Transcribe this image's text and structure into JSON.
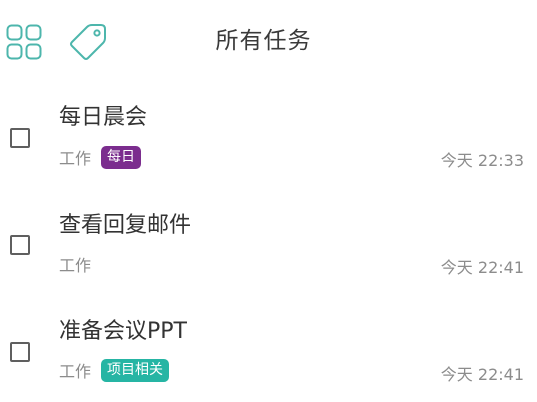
{
  "header": {
    "title": "所有任务",
    "menu_icon": "grid-icon",
    "tag_icon": "tag-icon",
    "accent_color": "#4db6ac"
  },
  "tasks": [
    {
      "title": "每日晨会",
      "list": "工作",
      "tag": "每日",
      "tag_color": "#7b2d8e",
      "time": "今天 22:33",
      "checked": false
    },
    {
      "title": "查看回复邮件",
      "list": "工作",
      "tag": "",
      "tag_color": "",
      "time": "今天 22:41",
      "checked": false
    },
    {
      "title": "准备会议PPT",
      "list": "工作",
      "tag": "项目相关",
      "tag_color": "#26b5a4",
      "time": "今天 22:41",
      "checked": false
    }
  ]
}
